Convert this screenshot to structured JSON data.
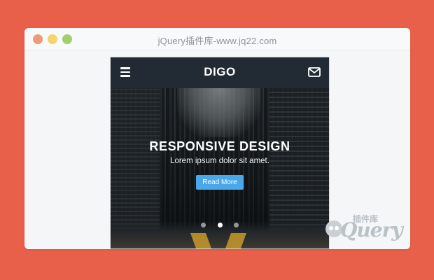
{
  "window": {
    "title": "jQuery插件库-www.jq22.com",
    "buttons": [
      "close",
      "minimize",
      "maximize"
    ],
    "colors": {
      "close": "#ef9b78",
      "minimize": "#f5d46b",
      "maximize": "#9fd06c"
    }
  },
  "app": {
    "brand": "DIGO",
    "menu_icon": "hamburger-icon",
    "mail_icon": "envelope-icon"
  },
  "hero": {
    "title": "RESPONSIVE DESIGN",
    "subtitle": "Lorem ipsum dolor sit amet.",
    "button_label": "Read More",
    "slides": 3,
    "active_slide": 2
  },
  "watermark": {
    "small": "插件库",
    "big": "Query"
  },
  "colors": {
    "page_bg": "#e8604a",
    "appbar": "#222b33",
    "accent": "#4aa8e8"
  }
}
